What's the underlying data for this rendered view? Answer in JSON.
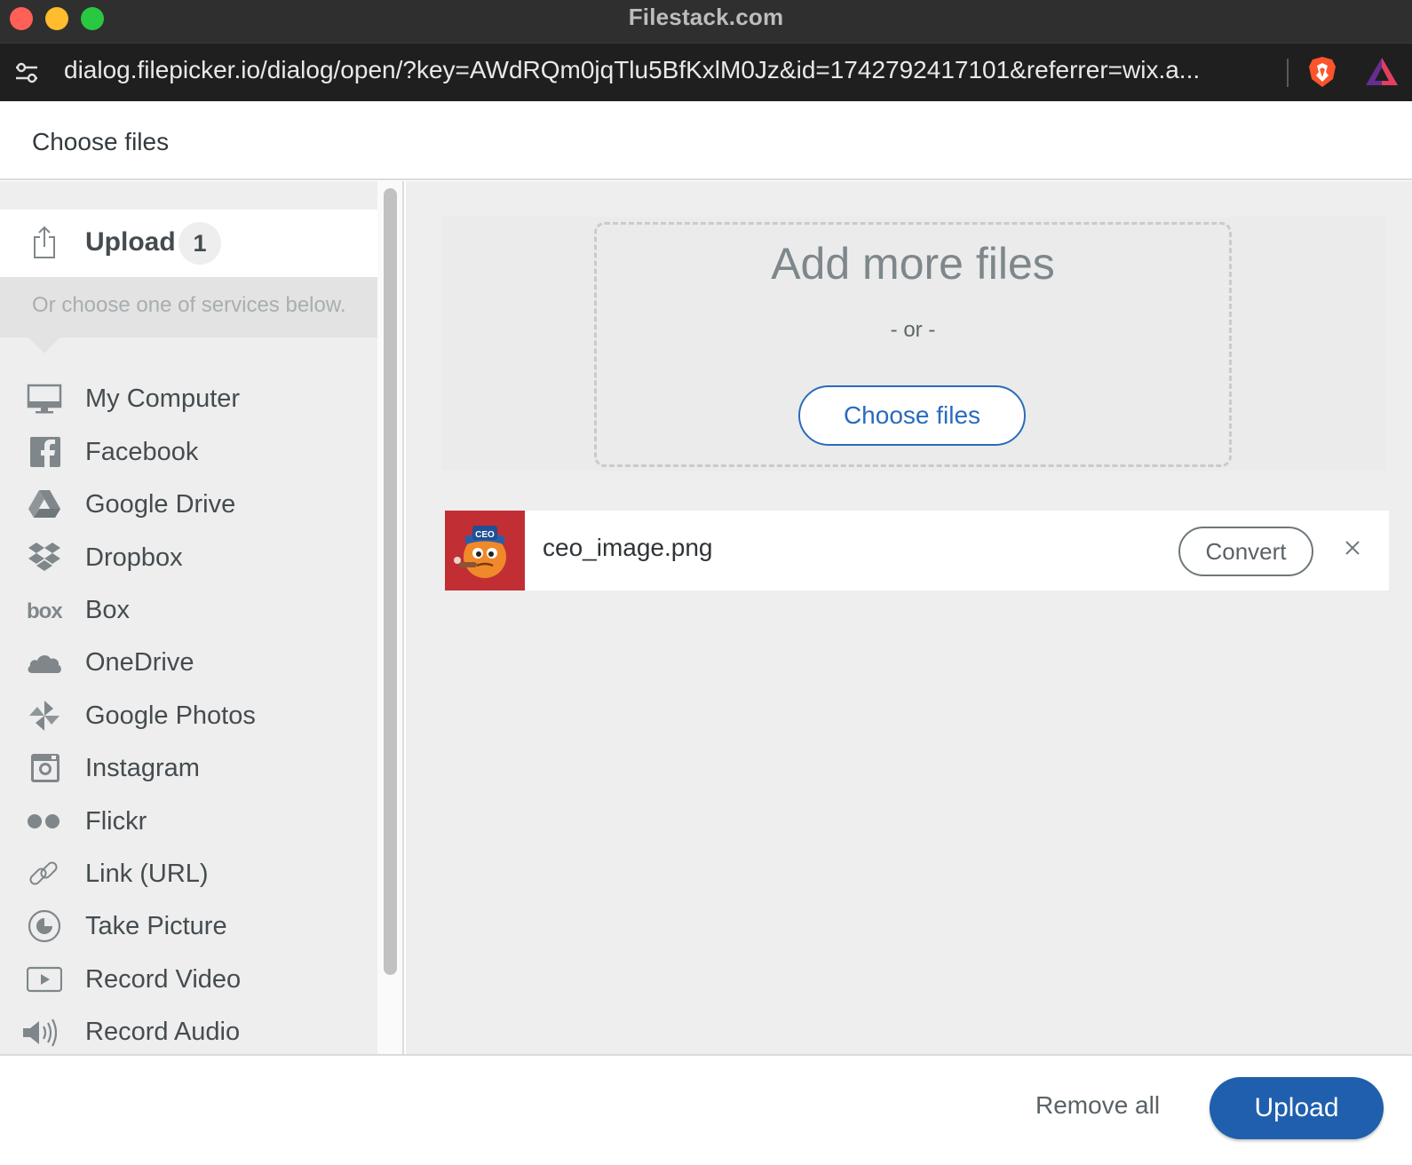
{
  "window": {
    "title": "Filestack.com"
  },
  "browser": {
    "url": "dialog.filepicker.io/dialog/open/?key=AWdRQm0jqTlu5BfKxlM0Jz&id=1742792417101&referrer=wix.a..."
  },
  "dialog": {
    "title": "Choose files"
  },
  "sidebar": {
    "upload_label": "Upload",
    "upload_count": "1",
    "services_hint": "Or choose one of services below.",
    "services": [
      {
        "label": "My Computer",
        "icon": "monitor-icon"
      },
      {
        "label": "Facebook",
        "icon": "facebook-icon"
      },
      {
        "label": "Google Drive",
        "icon": "google-drive-icon"
      },
      {
        "label": "Dropbox",
        "icon": "dropbox-icon"
      },
      {
        "label": "Box",
        "icon": "box-icon"
      },
      {
        "label": "OneDrive",
        "icon": "onedrive-icon"
      },
      {
        "label": "Google Photos",
        "icon": "google-photos-icon"
      },
      {
        "label": "Instagram",
        "icon": "instagram-icon"
      },
      {
        "label": "Flickr",
        "icon": "flickr-icon"
      },
      {
        "label": "Link (URL)",
        "icon": "link-icon"
      },
      {
        "label": "Take Picture",
        "icon": "camera-icon"
      },
      {
        "label": "Record Video",
        "icon": "video-icon"
      },
      {
        "label": "Record Audio",
        "icon": "audio-icon"
      }
    ]
  },
  "dropzone": {
    "title": "Add more files",
    "or_text": "- or -",
    "choose_label": "Choose files"
  },
  "files": [
    {
      "name": "ceo_image.png",
      "convert_label": "Convert",
      "thumb_badge": "CEO"
    }
  ],
  "footer": {
    "remove_all_label": "Remove all",
    "upload_label": "Upload"
  },
  "colors": {
    "accent": "#1f5fad",
    "link_blue": "#2a6bbd",
    "thumb_bg": "#c12f34"
  }
}
